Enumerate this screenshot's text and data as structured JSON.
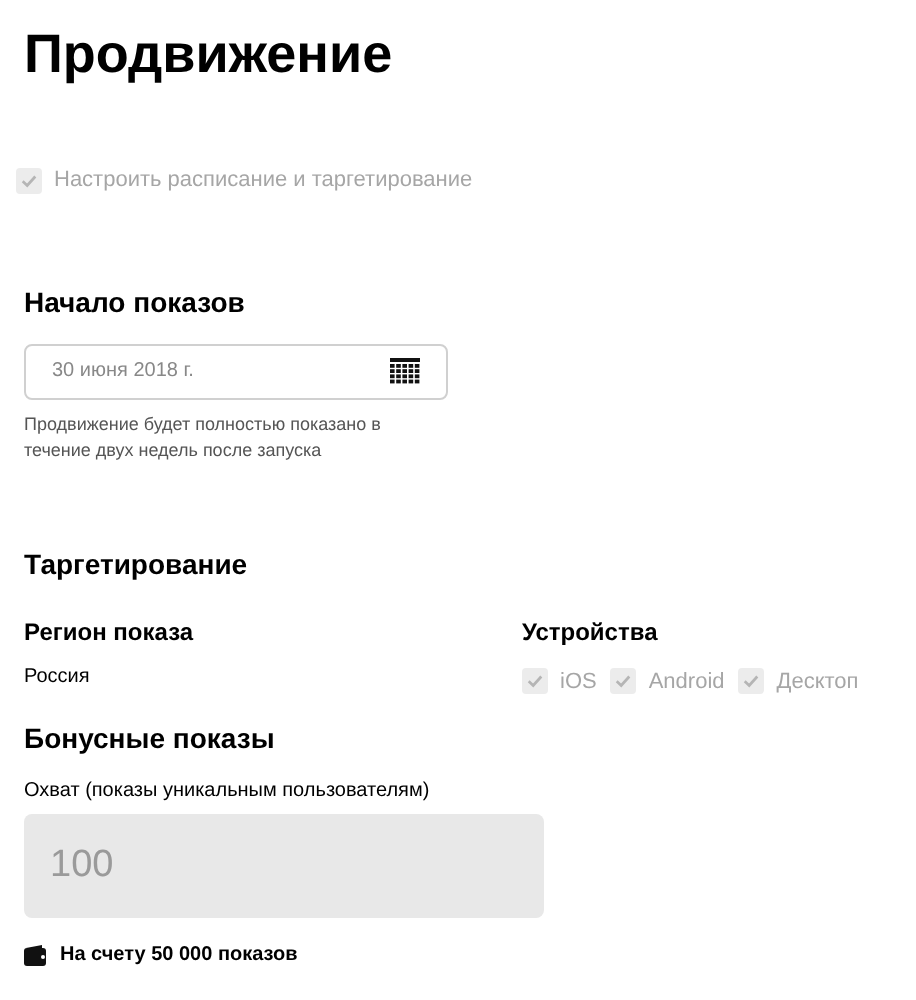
{
  "title": "Продвижение",
  "schedule_checkbox": {
    "label": "Настроить расписание и таргетирование",
    "checked": true,
    "disabled": true
  },
  "start": {
    "heading": "Начало показов",
    "date_field": {
      "value": "30 июня 2018 г."
    },
    "hint": "Продвижение будет полностью показано в течение двух недель после запуска"
  },
  "targeting": {
    "heading": "Таргетирование",
    "region": {
      "heading": "Регион показа",
      "value": "Россия"
    },
    "devices": {
      "heading": "Устройства",
      "items": [
        {
          "label": "iOS",
          "checked": true,
          "disabled": true
        },
        {
          "label": "Android",
          "checked": true,
          "disabled": true
        },
        {
          "label": "Десктоп",
          "checked": true,
          "disabled": true
        }
      ]
    }
  },
  "bonus": {
    "heading": "Бонусные показы",
    "reach_label": "Охват (показы уникальным пользователям)",
    "reach_field": {
      "value": "100",
      "disabled": true
    },
    "balance": "На счету 50 000 показов"
  }
}
